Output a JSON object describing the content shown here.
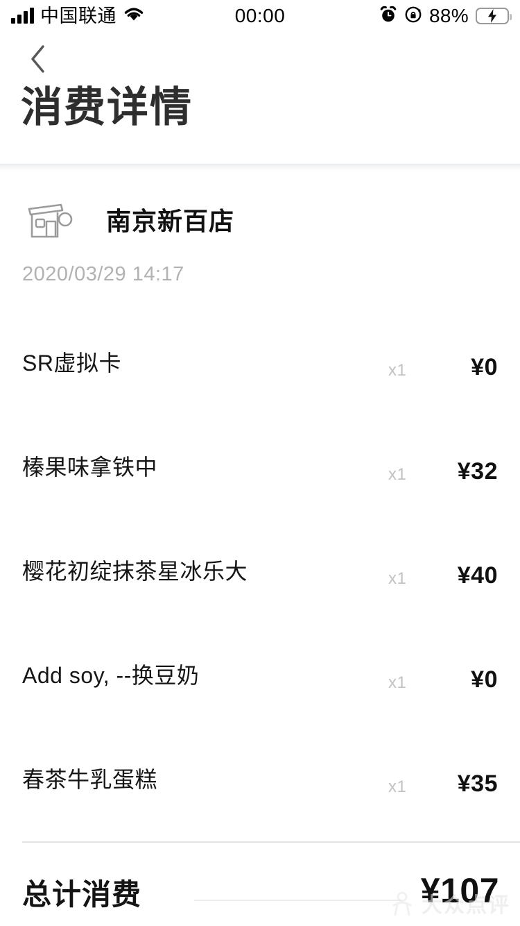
{
  "status_bar": {
    "carrier": "中国联通",
    "time": "00:00",
    "battery_percent": "88%",
    "icons": [
      "signal-bars-icon",
      "wifi-icon",
      "alarm-clock-icon",
      "rotation-lock-icon",
      "battery-charging-icon"
    ]
  },
  "nav": {
    "back_icon": "chevron-left-icon"
  },
  "header": {
    "title": "消费详情"
  },
  "store": {
    "icon": "storefront-icon",
    "name": "南京新百店",
    "datetime": "2020/03/29 14:17"
  },
  "items": [
    {
      "name": "SR虚拟卡",
      "qty": "x1",
      "price": "¥0"
    },
    {
      "name": "榛果味拿铁中",
      "qty": "x1",
      "price": "¥32"
    },
    {
      "name": "樱花初绽抹茶星冰乐大",
      "qty": "x1",
      "price": "¥40"
    },
    {
      "name": "Add soy, --换豆奶",
      "qty": "x1",
      "price": "¥0"
    },
    {
      "name": "春茶牛乳蛋糕",
      "qty": "x1",
      "price": "¥35"
    }
  ],
  "total": {
    "label": "总计消费",
    "value": "¥107"
  },
  "watermark": {
    "text": "大众点评",
    "logo_icon": "dianping-mascot-icon"
  },
  "colors": {
    "battery_green": "#4CD964",
    "text_primary": "#111111",
    "text_muted": "#b2b2b2",
    "divider": "#e3e3e3"
  }
}
